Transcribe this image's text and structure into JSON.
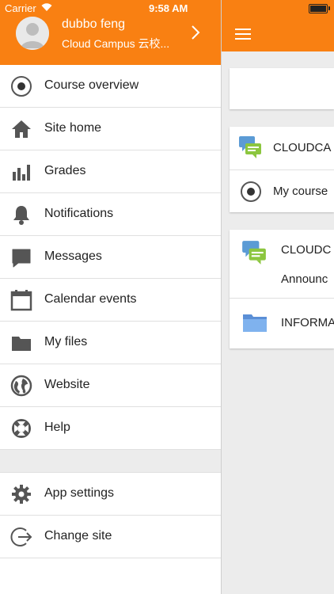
{
  "status_bar": {
    "carrier": "Carrier",
    "time": "9:58 AM"
  },
  "user": {
    "name": "dubbo feng",
    "site": "Cloud Campus 云校..."
  },
  "menu": {
    "items": [
      {
        "label": "Course overview",
        "icon": "course-overview-icon"
      },
      {
        "label": "Site home",
        "icon": "home-icon"
      },
      {
        "label": "Grades",
        "icon": "grades-icon"
      },
      {
        "label": "Notifications",
        "icon": "bell-icon"
      },
      {
        "label": "Messages",
        "icon": "message-icon"
      },
      {
        "label": "Calendar events",
        "icon": "calendar-icon"
      },
      {
        "label": "My files",
        "icon": "folder-icon"
      },
      {
        "label": "Website",
        "icon": "globe-icon"
      },
      {
        "label": "Help",
        "icon": "lifebuoy-icon"
      }
    ],
    "bottom_items": [
      {
        "label": "App settings",
        "icon": "gear-icon"
      },
      {
        "label": "Change site",
        "icon": "logout-icon"
      }
    ]
  },
  "content": {
    "block1": {
      "forum": "CLOUDCA",
      "courses": "My course"
    },
    "block2": {
      "forum": "CLOUDC",
      "announcements": "Announc",
      "folder": "INFORMA"
    }
  },
  "colors": {
    "brand": "#f98012",
    "icon_gray": "#555555"
  }
}
